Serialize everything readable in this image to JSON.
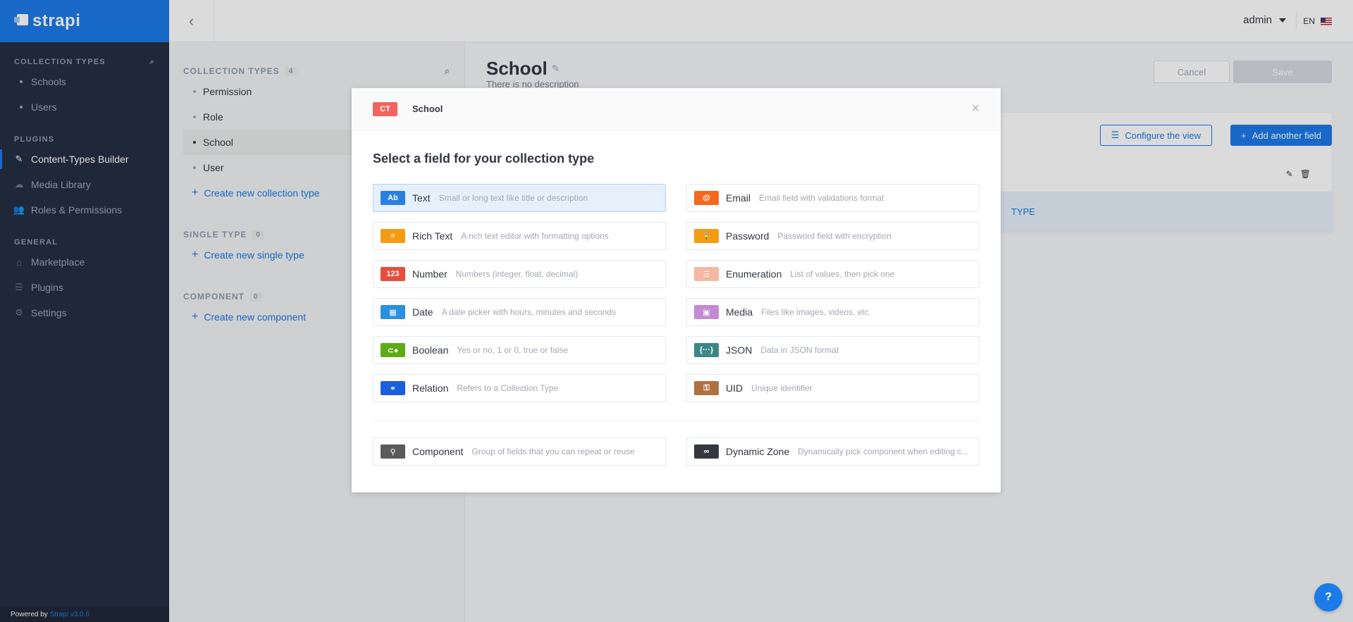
{
  "brand": {
    "name": "strapi"
  },
  "leftnav": {
    "collection_heading": "COLLECTION TYPES",
    "collection_items": [
      "Schools",
      "Users"
    ],
    "plugins_heading": "PLUGINS",
    "plugin_items": [
      {
        "label": "Content-Types Builder",
        "icon": "paintbrush-icon",
        "active": true
      },
      {
        "label": "Media Library",
        "icon": "cloud-icon",
        "active": false
      },
      {
        "label": "Roles & Permissions",
        "icon": "users-icon",
        "active": false
      }
    ],
    "general_heading": "GENERAL",
    "general_items": [
      {
        "label": "Marketplace",
        "icon": "shop-icon"
      },
      {
        "label": "Plugins",
        "icon": "list-icon"
      },
      {
        "label": "Settings",
        "icon": "gear-icon"
      }
    ],
    "footer_prefix": "Powered by",
    "footer_version": "Strapi v3.0.6"
  },
  "header": {
    "user": "admin",
    "lang": "EN"
  },
  "ctb_menu": {
    "collection_heading": "COLLECTION TYPES",
    "collection_count": "4",
    "collection_items": [
      "Permission",
      "Role",
      "School",
      "User"
    ],
    "create_collection": "Create new collection type",
    "single_heading": "SINGLE TYPE",
    "single_count": "0",
    "create_single": "Create new single type",
    "component_heading": "COMPONENT",
    "component_count": "0",
    "create_component": "Create new component"
  },
  "main": {
    "title": "School",
    "subtitle": "There is no description",
    "cancel": "Cancel",
    "save": "Save",
    "configure": "Configure the view",
    "add_field": "Add another field",
    "add_bar_text": "TYPE"
  },
  "modal": {
    "badge": "CT",
    "name": "School",
    "title": "Select a field for your collection type",
    "fields": [
      {
        "label": "Text",
        "desc": "Small or long text like title or description",
        "icon": "Ab",
        "color": "#2a7fe0",
        "selected": true
      },
      {
        "label": "Email",
        "desc": "Email field with validations format",
        "icon": "@",
        "color": "#f4691f"
      },
      {
        "label": "Rich Text",
        "desc": "A rich text editor with formatting options",
        "icon": "≡",
        "color": "#f39c12"
      },
      {
        "label": "Password",
        "desc": "Password field with encryption",
        "icon": "🔒",
        "color": "#f39c12"
      },
      {
        "label": "Number",
        "desc": "Numbers (integer, float, decimal)",
        "icon": "123",
        "color": "#e74c3c"
      },
      {
        "label": "Enumeration",
        "desc": "List of values, then pick one",
        "icon": "☰",
        "color": "#f5b7a2"
      },
      {
        "label": "Date",
        "desc": "A date picker with hours, minutes and seconds",
        "icon": "▦",
        "color": "#2a90e0"
      },
      {
        "label": "Media",
        "desc": "Files like images, videos, etc",
        "icon": "▣",
        "color": "#c48ad6"
      },
      {
        "label": "Boolean",
        "desc": "Yes or no, 1 or 0, true or false",
        "icon": "⊂●",
        "color": "#5dac16"
      },
      {
        "label": "JSON",
        "desc": "Data in JSON format",
        "icon": "{···}",
        "color": "#3c8786"
      },
      {
        "label": "Relation",
        "desc": "Refers to a Collection Type",
        "icon": "⚭",
        "color": "#1c5ee0"
      },
      {
        "label": "UID",
        "desc": "Unique identifier",
        "icon": "⚿",
        "color": "#b07040"
      }
    ],
    "extra": [
      {
        "label": "Component",
        "desc": "Group of fields that you can repeat or reuse",
        "icon": "⚲",
        "color": "#5a5a5a"
      },
      {
        "label": "Dynamic Zone",
        "desc": "Dynamically pick component when editing c...",
        "icon": "∞",
        "color": "#333740"
      }
    ]
  },
  "help": {
    "label": "?"
  }
}
